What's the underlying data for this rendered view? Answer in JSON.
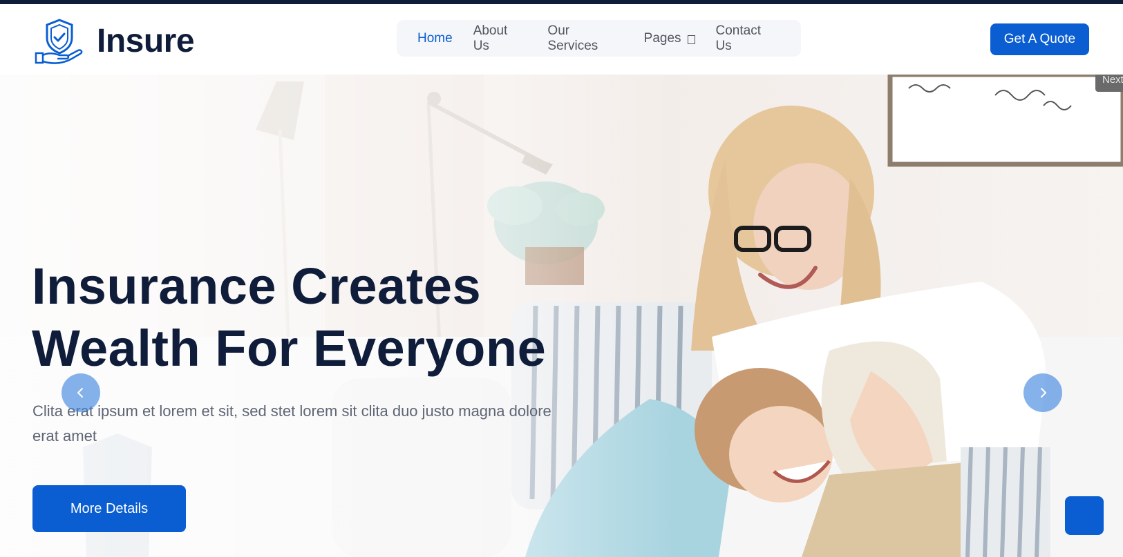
{
  "header": {
    "brand_name": "Insure",
    "brand_icon": "shield-check-hand-icon",
    "menu": [
      {
        "label": "Home",
        "active": true
      },
      {
        "label": "About Us",
        "active": false
      },
      {
        "label": "Our Services",
        "active": false
      },
      {
        "label": "Pages",
        "active": false
      },
      {
        "label": "Contact Us",
        "active": false
      }
    ],
    "quote_button": "Get A Quote"
  },
  "hero": {
    "title_line1": "Insurance Creates",
    "title_line2": "Wealth For Everyone",
    "subtitle": "Clita erat ipsum et lorem et sit, sed stet lorem sit clita duo justo magna dolore erat amet",
    "button_label": "More Details",
    "prev_icon": "chevron-left-icon",
    "next_icon": "chevron-right-icon",
    "next_tooltip": "Next",
    "background_image": "mother and child laughing on a white sofa"
  },
  "colors": {
    "primary": "#0a5ed1",
    "dark": "#0f1d3b",
    "text_muted": "#5e6574",
    "menu_bg": "#f4f6fa"
  },
  "back_to_top_icon": "arrow-up-icon"
}
